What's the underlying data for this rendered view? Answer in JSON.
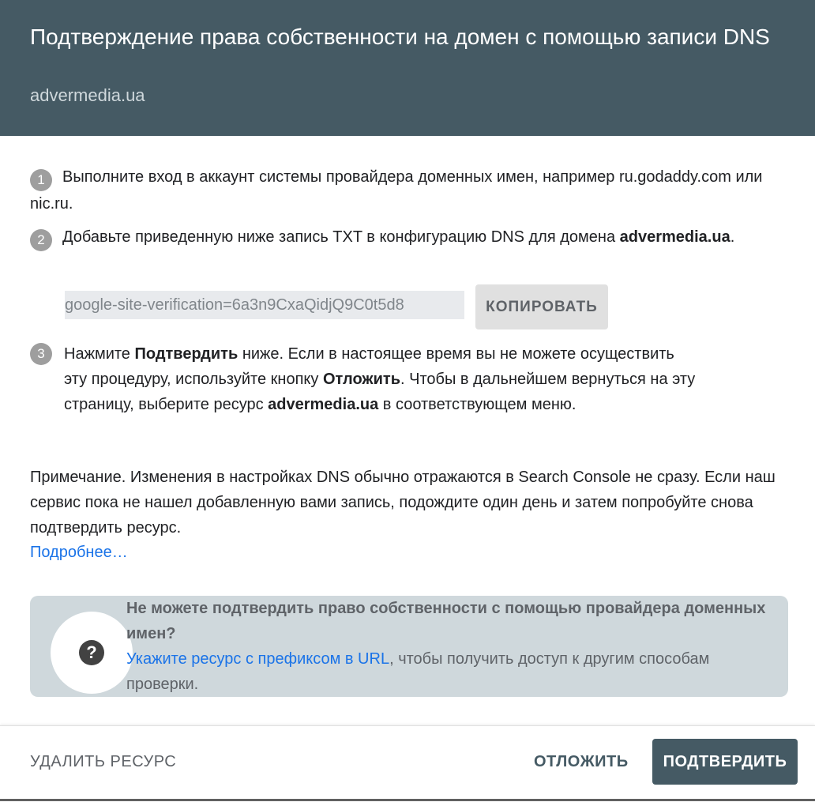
{
  "dialog": {
    "title": "Подтверждение права собственности на домен с помощью записи DNS",
    "domain": "advermedia.ua"
  },
  "steps": [
    {
      "number": "1",
      "text": "Выполните вход в аккаунт системы провайдера доменных имен, например ru.godaddy.com или nic.ru."
    },
    {
      "number": "2",
      "text_before": "Добавьте приведенную ниже запись TXT в конфигурацию DNS для домена ",
      "domain": "advermedia.ua",
      "text_after": "."
    },
    {
      "number": "3",
      "part1": "Нажмите ",
      "bold1": "Подтвердить",
      "part2": " ниже. Если в настоящее время вы не можете осуществить эту процедуру, используйте кнопку ",
      "bold2": "Отложить",
      "part3": ". Чтобы в дальнейшем вернуться на эту страницу, выберите ресурс ",
      "bold3": "advermedia.ua",
      "part4": " в соответствующем меню."
    }
  ],
  "txt_record": {
    "value": "google-site-verification=6a3n9CxaQidjQ9C0t5d8",
    "copy_label": "КОПИРОВАТЬ"
  },
  "note": {
    "text": "Примечание. Изменения в настройках DNS обычно отражаются в Search Console не сразу. Если наш сервис пока не нашел добавленную вами запись, подождите один день и затем попробуйте снова подтвердить ресурс.",
    "link": "Подробнее…"
  },
  "info_card": {
    "icon": "help-icon",
    "icon_glyph": "?",
    "heading": "Не можете подтвердить право собственности с помощью провайдера доменных имен?",
    "link": "Укажите ресурс с префиксом в URL",
    "text": ", чтобы получить доступ к другим способам проверки."
  },
  "footer": {
    "delete_label": "УДАЛИТЬ РЕСУРС",
    "later_label": "ОТЛОЖИТЬ",
    "verify_label": "ПОДТВЕРДИТЬ"
  },
  "colors": {
    "header_bg": "#455a64",
    "card_bg": "#cfd8dc",
    "link": "#1a73e8",
    "primary_button": "#455a64"
  }
}
